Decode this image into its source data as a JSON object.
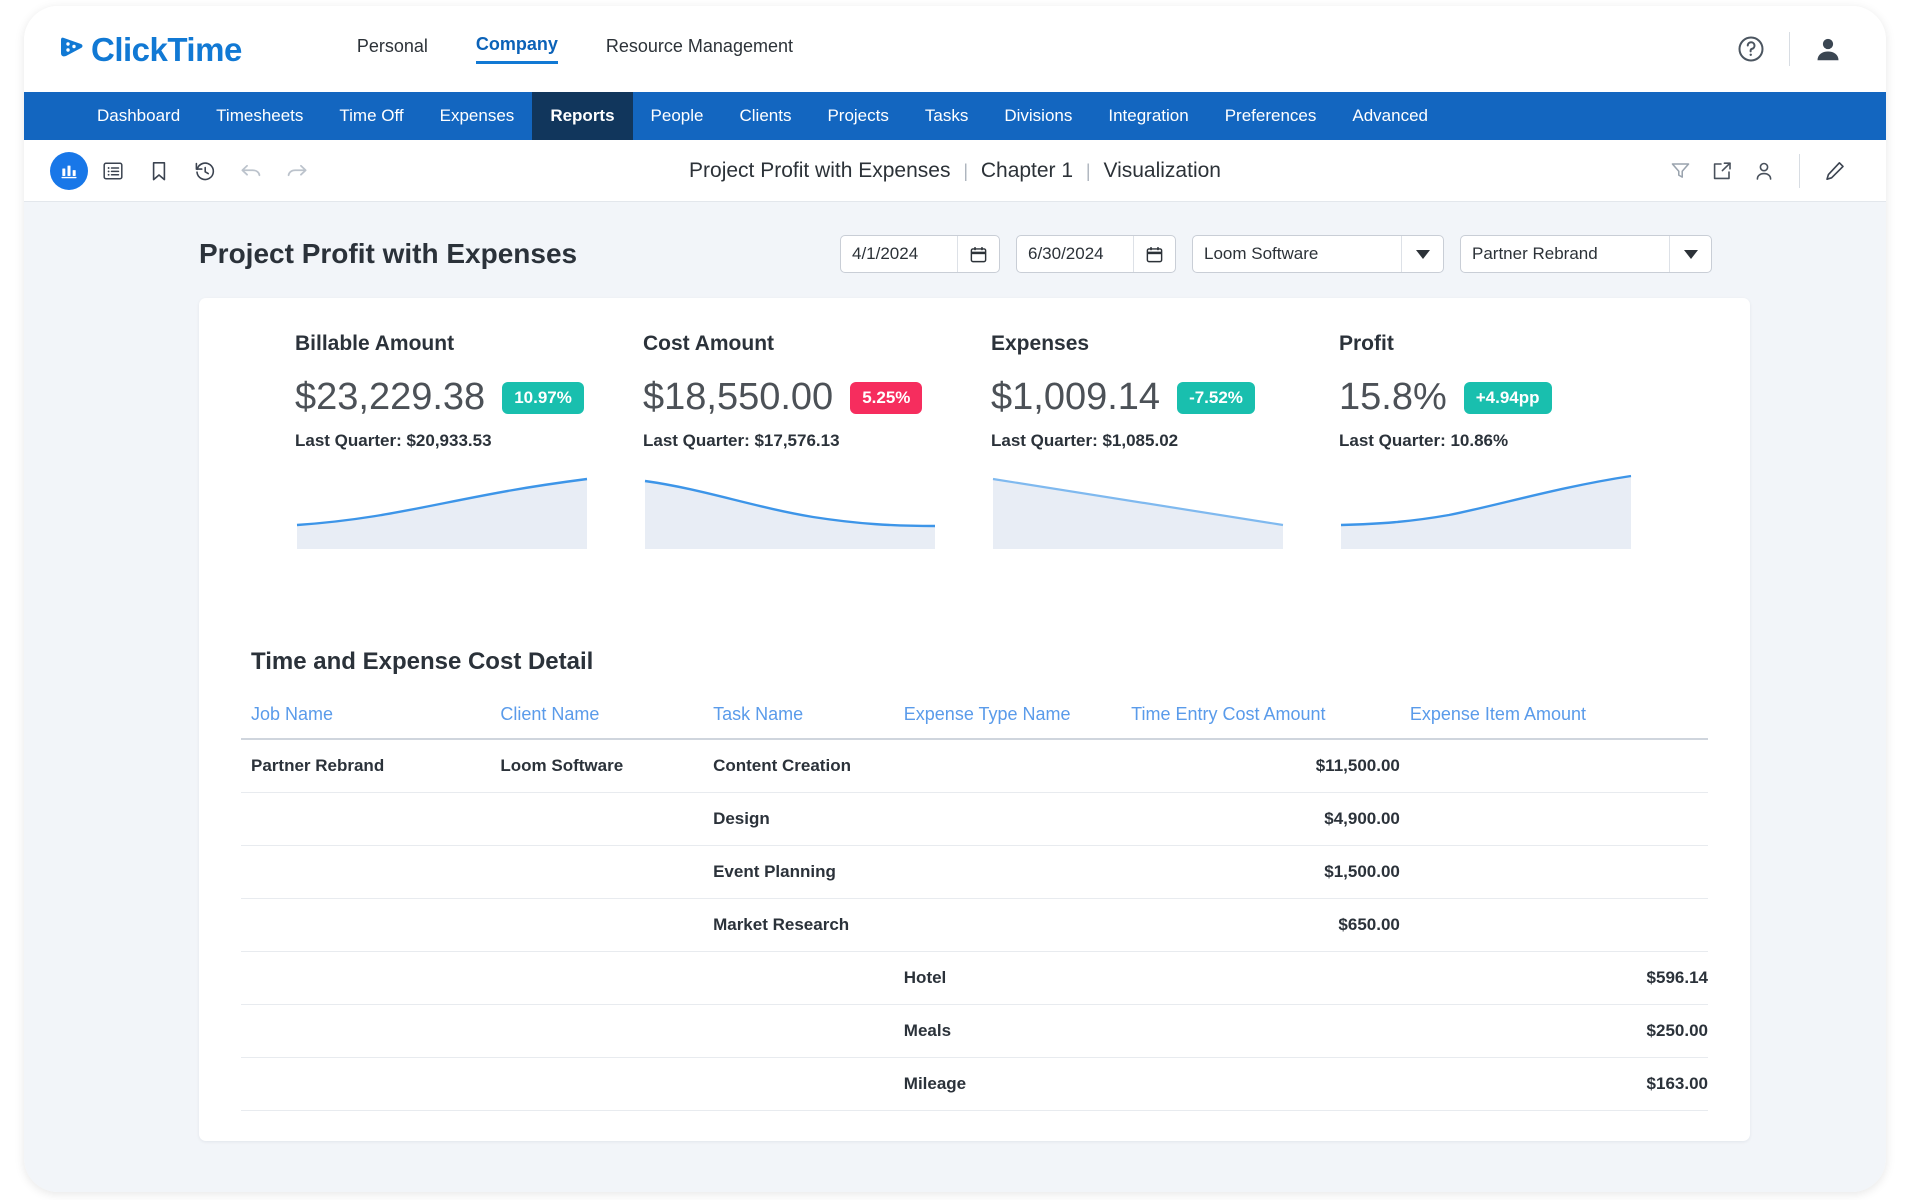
{
  "brand": {
    "name": "ClickTime",
    "nav": [
      {
        "label": "Personal",
        "active": false
      },
      {
        "label": "Company",
        "active": true
      },
      {
        "label": "Resource Management",
        "active": false
      }
    ],
    "help_icon": "question-circle-icon",
    "account_icon": "user-icon"
  },
  "main_nav": [
    {
      "label": "Dashboard",
      "active": false
    },
    {
      "label": "Timesheets",
      "active": false
    },
    {
      "label": "Time Off",
      "active": false
    },
    {
      "label": "Expenses",
      "active": false
    },
    {
      "label": "Reports",
      "active": true
    },
    {
      "label": "People",
      "active": false
    },
    {
      "label": "Clients",
      "active": false
    },
    {
      "label": "Projects",
      "active": false
    },
    {
      "label": "Tasks",
      "active": false
    },
    {
      "label": "Divisions",
      "active": false
    },
    {
      "label": "Integration",
      "active": false
    },
    {
      "label": "Preferences",
      "active": false
    },
    {
      "label": "Advanced",
      "active": false
    }
  ],
  "report_toolbar": {
    "left_icons": [
      "report-chart-icon",
      "list-view-icon",
      "bookmark-icon",
      "history-icon",
      "undo-icon",
      "redo-icon"
    ],
    "right_icons": [
      "filter-icon",
      "share-icon",
      "user-icon",
      "edit-pencil-icon"
    ],
    "breadcrumb": {
      "report": "Project Profit with Expenses",
      "chapter": "Chapter 1",
      "view": "Visualization",
      "separator": "|"
    }
  },
  "page": {
    "title": "Project Profit with Expenses",
    "filters": {
      "start_date": "4/1/2024",
      "end_date": "6/30/2024",
      "client": "Loom Software",
      "project": "Partner Rebrand"
    }
  },
  "kpis": [
    {
      "label": "Billable Amount",
      "value": "$23,229.38",
      "badge": "10.97%",
      "badge_color": "#19bfae",
      "last_quarter": "Last Quarter: $20,933.53",
      "trend": "up"
    },
    {
      "label": "Cost Amount",
      "value": "$18,550.00",
      "badge": "5.25%",
      "badge_color": "#f62d5e",
      "last_quarter": "Last Quarter: $17,576.13",
      "trend": "down"
    },
    {
      "label": "Expenses",
      "value": "$1,009.14",
      "badge": "-7.52%",
      "badge_color": "#19bfae",
      "last_quarter": "Last Quarter: $1,085.02",
      "trend": "down"
    },
    {
      "label": "Profit",
      "value": "15.8%",
      "badge": "+4.94pp",
      "badge_color": "#19bfae",
      "last_quarter": "Last Quarter: 10.86%",
      "trend": "up"
    }
  ],
  "chart_data": [
    {
      "type": "area",
      "title": "Billable Amount sparkline",
      "x": [
        0,
        1,
        2,
        3,
        4,
        5
      ],
      "values": [
        20933.53,
        21100,
        21600,
        22300,
        22900,
        23229.38
      ],
      "xlabel": "",
      "ylabel": "",
      "grid": false,
      "legend": "none"
    },
    {
      "type": "area",
      "title": "Cost Amount sparkline",
      "x": [
        0,
        1,
        2,
        3,
        4,
        5
      ],
      "values": [
        19800,
        19400,
        18900,
        18600,
        18500,
        18550.0
      ],
      "xlabel": "",
      "ylabel": "",
      "grid": false,
      "legend": "none"
    },
    {
      "type": "area",
      "title": "Expenses sparkline",
      "x": [
        0,
        1,
        2,
        3,
        4,
        5
      ],
      "values": [
        1085.02,
        1070,
        1058,
        1040,
        1022,
        1009.14
      ],
      "xlabel": "",
      "ylabel": "",
      "grid": false,
      "legend": "none"
    },
    {
      "type": "area",
      "title": "Profit sparkline",
      "x": [
        0,
        1,
        2,
        3,
        4,
        5
      ],
      "values": [
        10.86,
        10.95,
        11.2,
        12.6,
        14.3,
        15.8
      ],
      "xlabel": "",
      "ylabel": "",
      "grid": false,
      "legend": "none"
    }
  ],
  "detail": {
    "title": "Time and Expense Cost Detail",
    "columns": [
      "Job Name",
      "Client Name",
      "Task Name",
      "Expense Type Name",
      "Time Entry Cost Amount",
      "Expense Item Amount"
    ],
    "rows": [
      {
        "job": "Partner Rebrand",
        "client": "Loom Software",
        "task": "Content Creation",
        "expense_type": "",
        "time_cost": "$11,500.00",
        "expense_amount": ""
      },
      {
        "job": "",
        "client": "",
        "task": "Design",
        "expense_type": "",
        "time_cost": "$4,900.00",
        "expense_amount": ""
      },
      {
        "job": "",
        "client": "",
        "task": "Event Planning",
        "expense_type": "",
        "time_cost": "$1,500.00",
        "expense_amount": ""
      },
      {
        "job": "",
        "client": "",
        "task": "Market Research",
        "expense_type": "",
        "time_cost": "$650.00",
        "expense_amount": ""
      },
      {
        "job": "",
        "client": "",
        "task": "",
        "expense_type": "Hotel",
        "time_cost": "",
        "expense_amount": "$596.14"
      },
      {
        "job": "",
        "client": "",
        "task": "",
        "expense_type": "Meals",
        "time_cost": "",
        "expense_amount": "$250.00"
      },
      {
        "job": "",
        "client": "",
        "task": "",
        "expense_type": "Mileage",
        "time_cost": "",
        "expense_amount": "$163.00"
      }
    ]
  }
}
